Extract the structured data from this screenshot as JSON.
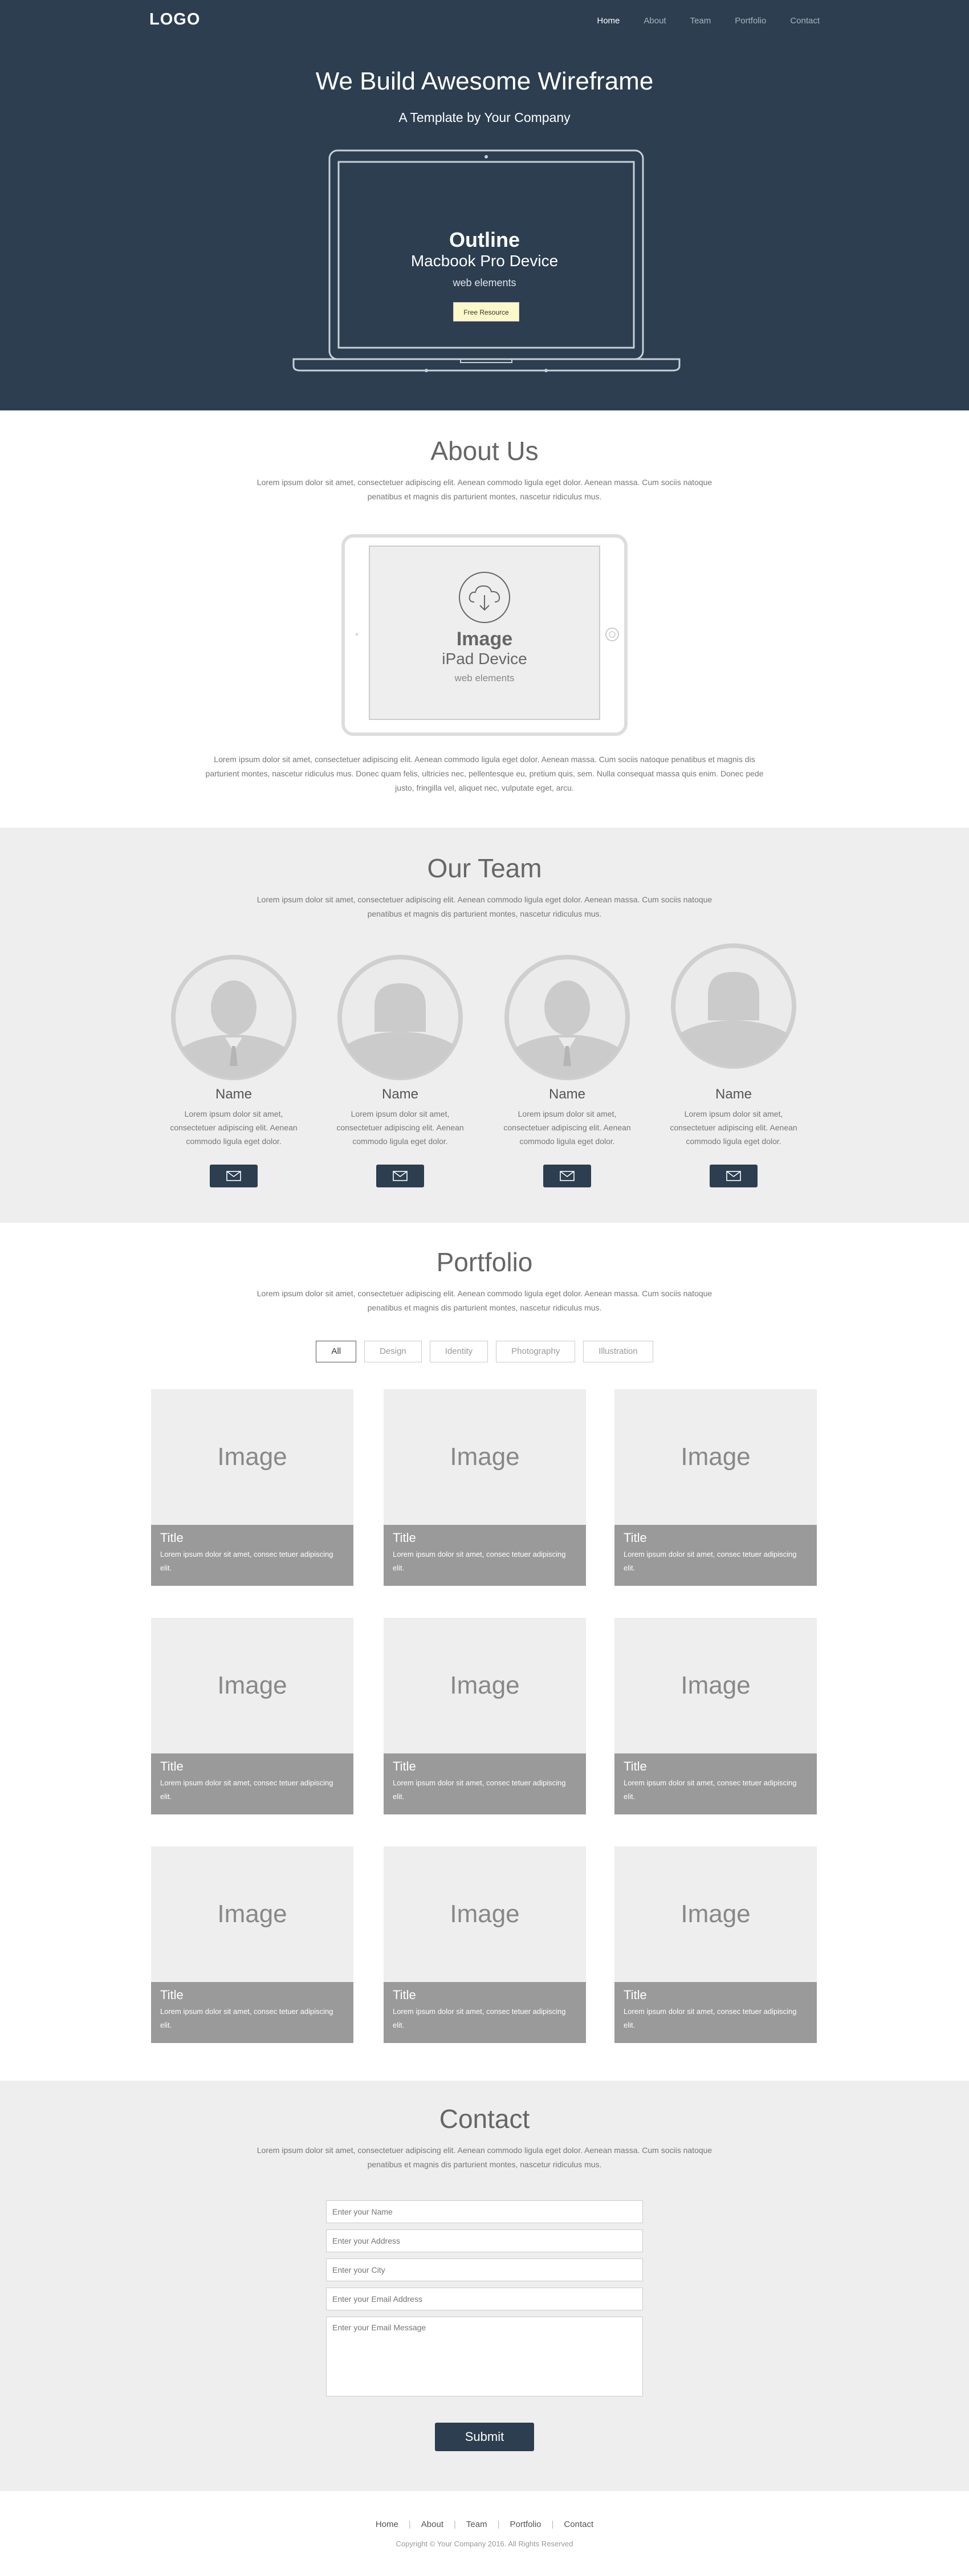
{
  "header": {
    "logo": "LOGO",
    "nav": [
      "Home",
      "About",
      "Team",
      "Portfolio",
      "Contact"
    ],
    "title": "We Build Awesome Wireframe",
    "subtitle": "A Template by Your Company",
    "laptop": {
      "heading": "Outline",
      "device": "Macbook Pro Device",
      "caption": "web elements",
      "button": "Free Resource"
    }
  },
  "about": {
    "title": "About Us",
    "intro": "Lorem ipsum dolor sit amet, consectetuer adipiscing elit. Aenean commodo ligula eget dolor. Aenean massa. Cum sociis natoque penatibus et magnis dis parturient montes, nascetur ridiculus mus.",
    "ipad": {
      "heading": "Image",
      "device": "iPad  Device",
      "caption": "web elements"
    },
    "body": "Lorem ipsum dolor sit amet, consectetuer adipiscing elit. Aenean commodo ligula eget dolor. Aenean massa. Cum sociis natoque penatibus et magnis dis parturient montes, nascetur ridiculus mus. Donec quam felis, ultricies nec, pellentesque eu, pretium quis, sem. Nulla consequat massa quis enim. Donec pede justo, fringilla vel, aliquet nec, vulputate eget, arcu."
  },
  "team": {
    "title": "Our Team",
    "intro": "Lorem ipsum dolor sit amet, consectetuer adipiscing elit. Aenean commodo ligula eget dolor. Aenean massa. Cum sociis natoque penatibus et magnis dis parturient montes, nascetur ridiculus mus.",
    "members": [
      {
        "name": "Name",
        "desc": "Lorem ipsum dolor sit amet, consectetuer adipiscing elit. Aenean commodo ligula eget dolor."
      },
      {
        "name": "Name",
        "desc": "Lorem ipsum dolor sit amet, consectetuer adipiscing elit. Aenean commodo ligula eget dolor."
      },
      {
        "name": "Name",
        "desc": "Lorem ipsum dolor sit amet, consectetuer adipiscing elit. Aenean commodo ligula eget dolor."
      },
      {
        "name": "Name",
        "desc": "Lorem ipsum dolor sit amet, consectetuer adipiscing elit. Aenean commodo ligula eget dolor."
      }
    ]
  },
  "portfolio": {
    "title": "Portfolio",
    "intro": "Lorem ipsum dolor sit amet, consectetuer adipiscing elit. Aenean commodo ligula eget dolor. Aenean massa. Cum sociis natoque penatibus et magnis dis parturient montes, nascetur ridiculus mus.",
    "filters": [
      "All",
      "Design",
      "Identity",
      "Photography",
      "Illustration"
    ],
    "items": [
      {
        "image": "Image",
        "title": "Title",
        "desc": "Lorem ipsum dolor sit amet, consec tetuer adipiscing elit."
      },
      {
        "image": "Image",
        "title": "Title",
        "desc": "Lorem ipsum dolor sit amet, consec tetuer adipiscing elit."
      },
      {
        "image": "Image",
        "title": "Title",
        "desc": "Lorem ipsum dolor sit amet, consec tetuer adipiscing elit."
      },
      {
        "image": "Image",
        "title": "Title",
        "desc": "Lorem ipsum dolor sit amet, consec tetuer adipiscing elit."
      },
      {
        "image": "Image",
        "title": "Title",
        "desc": "Lorem ipsum dolor sit amet, consec tetuer adipiscing elit."
      },
      {
        "image": "Image",
        "title": "Title",
        "desc": "Lorem ipsum dolor sit amet, consec tetuer adipiscing elit."
      },
      {
        "image": "Image",
        "title": "Title",
        "desc": "Lorem ipsum dolor sit amet, consec tetuer adipiscing elit."
      },
      {
        "image": "Image",
        "title": "Title",
        "desc": "Lorem ipsum dolor sit amet, consec tetuer adipiscing elit."
      },
      {
        "image": "Image",
        "title": "Title",
        "desc": "Lorem ipsum dolor sit amet, consec tetuer adipiscing elit."
      }
    ]
  },
  "contact": {
    "title": "Contact",
    "intro": "Lorem ipsum dolor sit amet, consectetuer adipiscing elit. Aenean commodo ligula eget dolor. Aenean massa. Cum sociis natoque penatibus et magnis dis parturient montes, nascetur ridiculus mus.",
    "name_placeholder": "Enter your Name",
    "address_placeholder": "Enter your Address",
    "city_placeholder": "Enter your City",
    "email_placeholder": "Enter your Email Address",
    "message_placeholder": "Enter your Email Message",
    "submit": "Submit"
  },
  "footer": {
    "nav": [
      "Home",
      "About",
      "Team",
      "Portfolio",
      "Contact"
    ],
    "copyright": "Copyright © Your Company 2016. All Rights Reserved"
  },
  "colors": {
    "primary": "#2c3e50",
    "section_gray": "#eeeeee",
    "caption_gray": "#9a9a9a",
    "button_yellow": "#fdf8c9"
  }
}
